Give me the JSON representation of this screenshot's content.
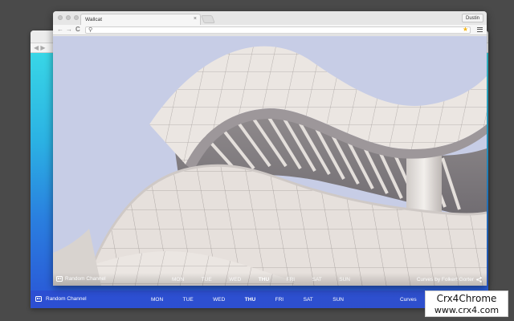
{
  "back_window": {
    "nav_buttons": "◀ ▶",
    "channel_label": "Random Channel",
    "days": [
      "MON",
      "TUE",
      "WED",
      "THU",
      "FRI",
      "SAT",
      "SUN"
    ],
    "active_day": "THU",
    "credit": "Curves"
  },
  "front_window": {
    "tab_title": "Wallcat",
    "tab_close": "×",
    "profile_name": "Dustin",
    "address_value": "",
    "icons": {
      "back": "←",
      "forward": "→",
      "reload": "C",
      "search": "⚲",
      "star": "★"
    },
    "overlay": {
      "channel_label": "Random Channel",
      "days": [
        "MON",
        "TUE",
        "WED",
        "THU",
        "FRI",
        "SAT",
        "SUN"
      ],
      "active_day": "THU",
      "credit": "Curves by Folkert Gorter"
    }
  },
  "watermark": {
    "line1": "Crx4Chrome",
    "line2": "www.crx4.com"
  },
  "colors": {
    "desktop": "#4a4a4a",
    "sky": "#c7cde6",
    "building": "#e9e4e0",
    "back_gradient_top": "#38d6e6",
    "back_gradient_bottom": "#2a55d6",
    "star": "#f2b51b"
  }
}
